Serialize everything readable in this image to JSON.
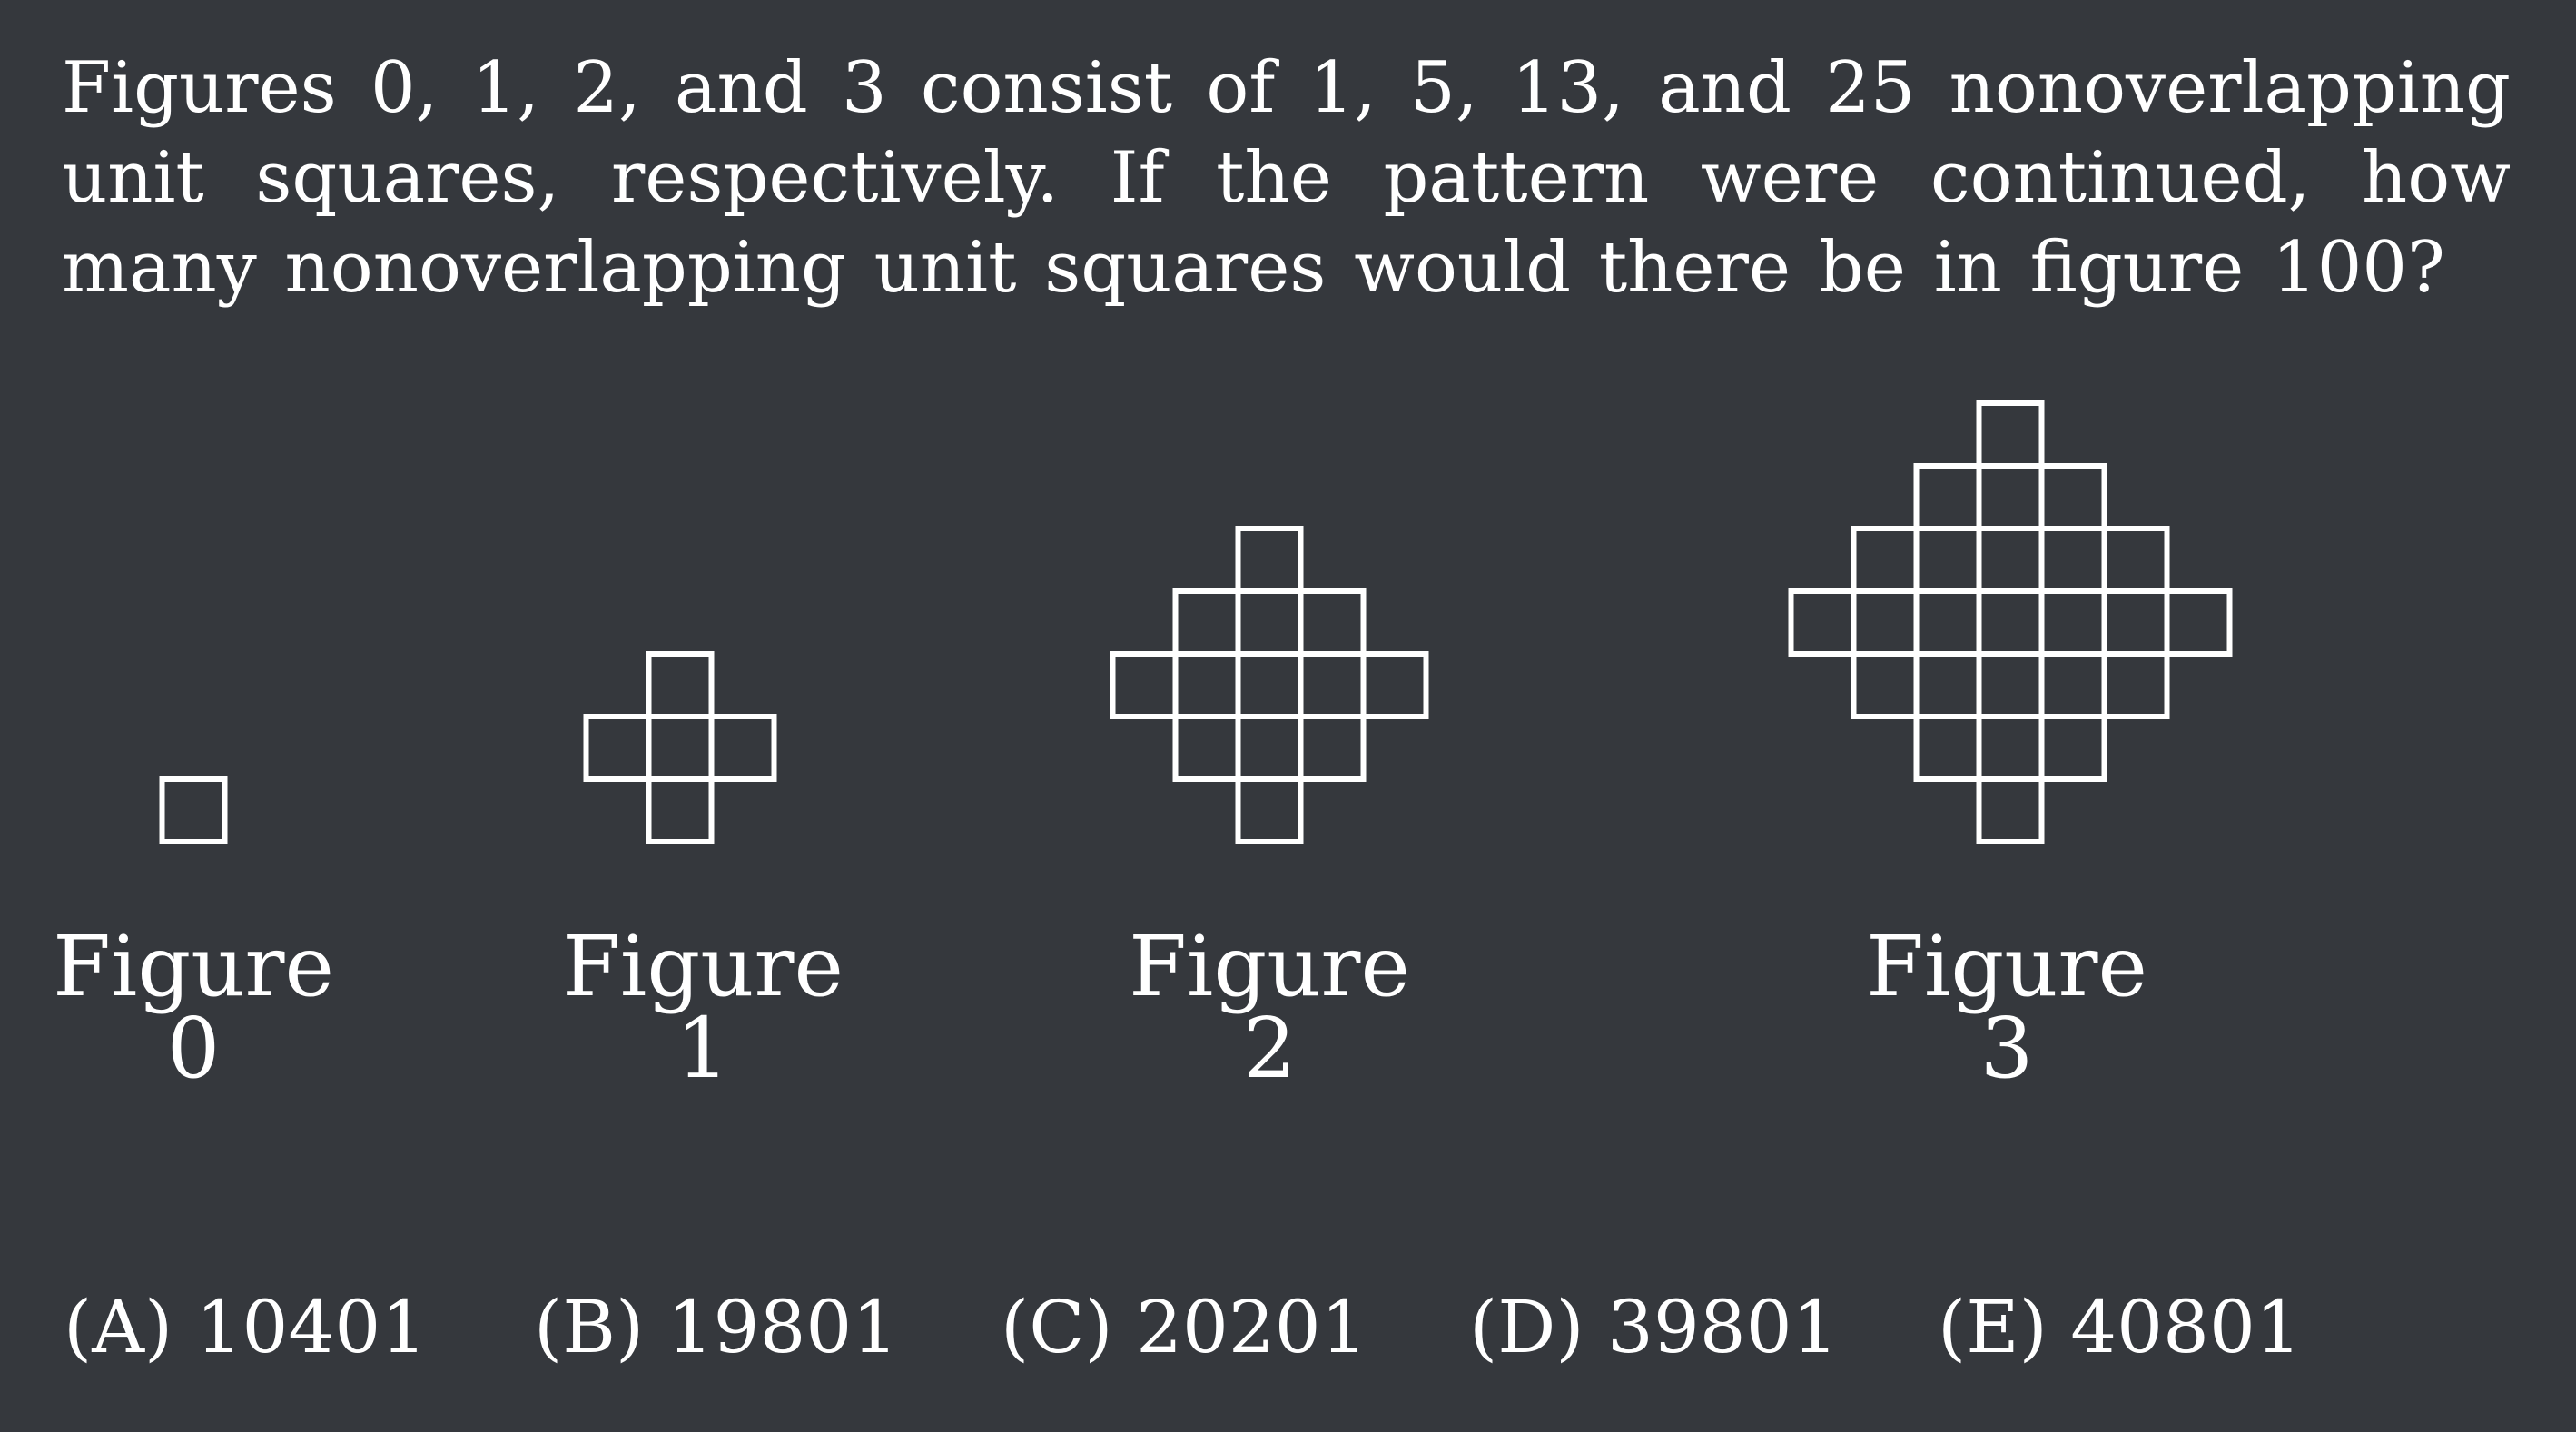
{
  "question": "Figures 0, 1, 2, and 3 consist of 1, 5, 13, and 25 nonoverlapping unit squares, respectively.  If the pattern were continued, how many nonoverlapping unit squares would there be in figure 100?",
  "figures": [
    {
      "word": "Figure",
      "number": "0",
      "n": 0
    },
    {
      "word": "Figure",
      "number": "1",
      "n": 1
    },
    {
      "word": "Figure",
      "number": "2",
      "n": 2
    },
    {
      "word": "Figure",
      "number": "3",
      "n": 3
    }
  ],
  "choices": [
    {
      "label": "(A) 10401"
    },
    {
      "label": "(B) 19801"
    },
    {
      "label": "(C) 20201"
    },
    {
      "label": "(D) 39801"
    },
    {
      "label": "(E) 40801"
    }
  ],
  "colors": {
    "background": "#35383d",
    "foreground": "#ffffff"
  }
}
